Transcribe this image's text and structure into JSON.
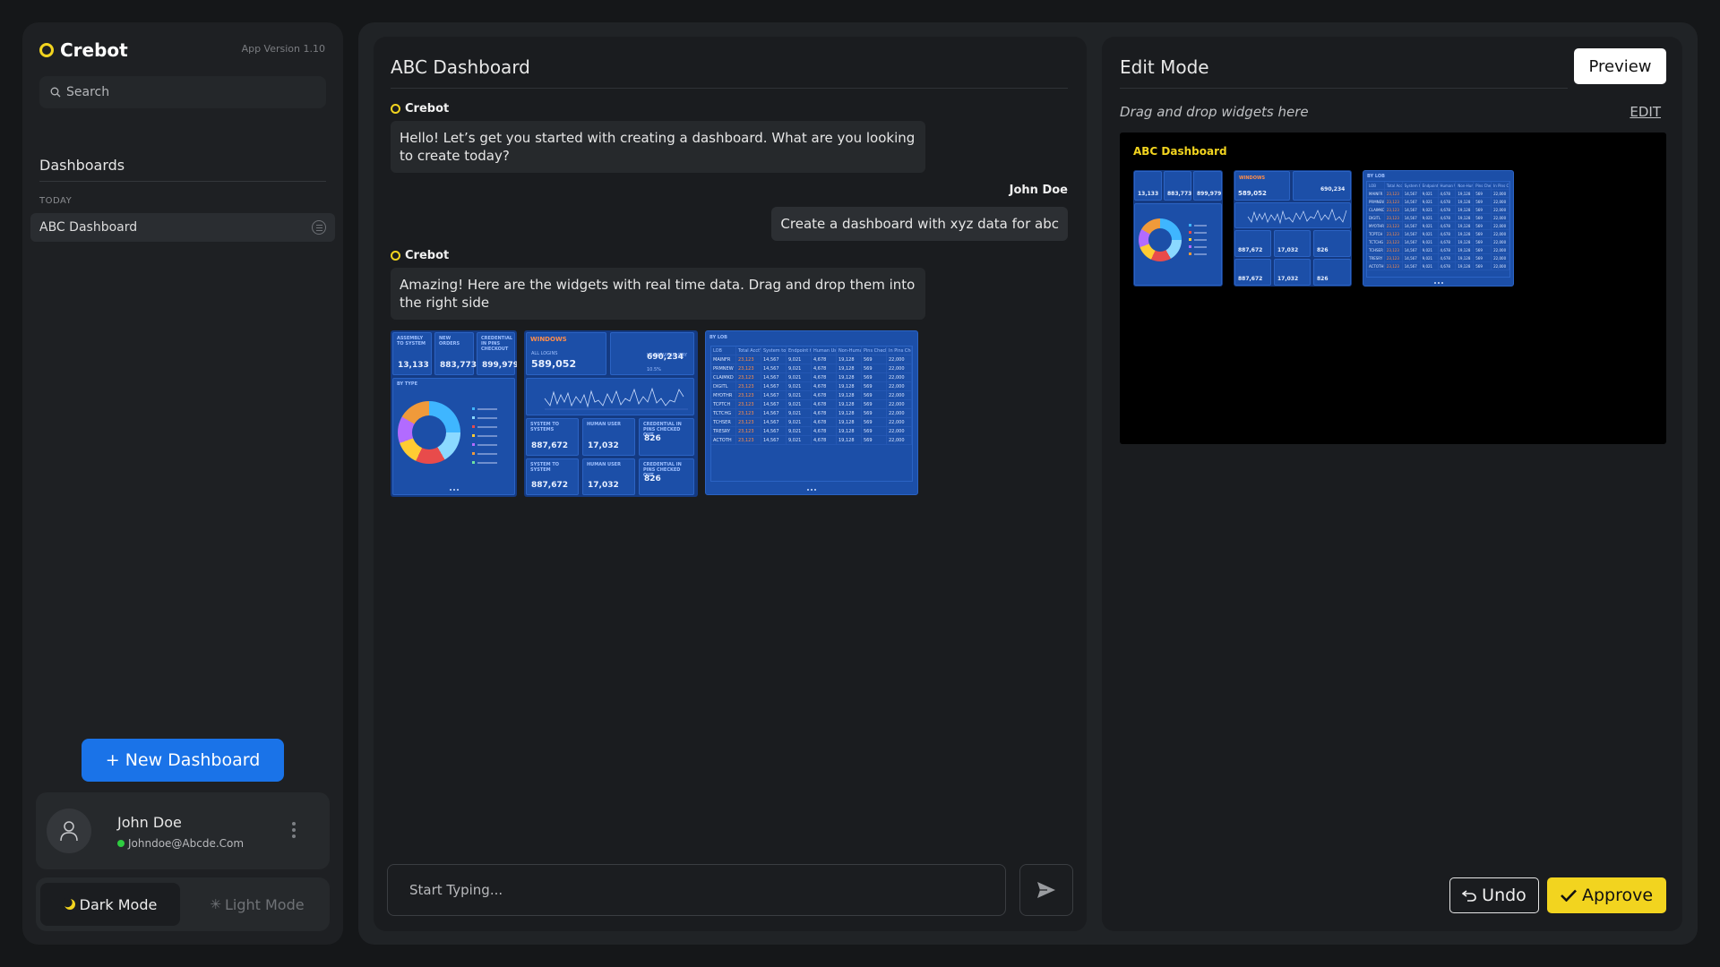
{
  "app": {
    "name": "Crebot",
    "version": "App Version 1.10"
  },
  "sidebar": {
    "search_placeholder": "Search",
    "section_title": "Dashboards",
    "group_label": "TODAY",
    "items": [
      {
        "label": "ABC Dashboard"
      }
    ],
    "new_dashboard_label": "+ New Dashboard",
    "user": {
      "name": "John Doe",
      "email": "Johndoe@Abcde.Com",
      "status_color": "#2ecc40"
    },
    "modes": {
      "dark_label": "Dark Mode",
      "light_label": "Light Mode",
      "active": "dark"
    }
  },
  "chat": {
    "title": "ABC Dashboard",
    "messages": [
      {
        "sender": "Crebot",
        "text": "Hello! Let’s get you started with creating a dashboard. What are you looking to create today?"
      },
      {
        "sender": "John Doe",
        "text": "Create a dashboard with xyz data for abc"
      },
      {
        "sender": "Crebot",
        "text": "Amazing! Here are the widgets with real time data. Drag and drop them into the right side"
      }
    ],
    "composer_placeholder": "Start Typing..."
  },
  "widgets": {
    "kpi": {
      "tiles": [
        {
          "title": "ASSEMBLY TO SYSTEM",
          "value": "13,133"
        },
        {
          "title": "NEW ORDERS",
          "value": "883,773"
        },
        {
          "title": "CREDENTIAL IN PINS CHECKOUT",
          "value": "899,979"
        }
      ],
      "donut_title": "BY TYPE"
    },
    "windows": {
      "title": "WINDOWS",
      "all_logins_label": "ALL LOGINS",
      "all_logins_value": "589,052",
      "prev_label": "VS PREVIOUS DAY",
      "prev_value": "690,234",
      "prev_pct": "10.5%",
      "tiles": [
        {
          "title": "SYSTEM TO SYSTEMS",
          "value": "887,672"
        },
        {
          "title": "HUMAN USER",
          "value": "17,032"
        },
        {
          "title": "CREDENTIAL IN PINS CHECKED OUT",
          "value": "826"
        },
        {
          "title": "SYSTEM TO SYSTEM",
          "value": "887,672"
        },
        {
          "title": "HUMAN USER",
          "value": "17,032"
        },
        {
          "title": "CREDENTIAL IN PINS CHECKED OUT",
          "value": "826"
        }
      ]
    },
    "table": {
      "title": "BY LOB",
      "headers": [
        "LOB",
        "Total Acct's",
        "System to System",
        "Endpoint to System",
        "Human User",
        "Non-Human User",
        "Pins Checked",
        "In Pins Checked"
      ],
      "rows": [
        [
          "MAINFR",
          "23,123",
          "14,567",
          "9,021",
          "4,678",
          "19,128",
          "569",
          "22,000"
        ],
        [
          "PRMNEW",
          "23,123",
          "14,567",
          "9,021",
          "4,678",
          "19,128",
          "569",
          "22,000"
        ],
        [
          "CLAIMKD",
          "23,123",
          "14,567",
          "9,021",
          "4,678",
          "19,128",
          "569",
          "22,000"
        ],
        [
          "DIGITL",
          "23,123",
          "14,567",
          "9,021",
          "4,678",
          "19,128",
          "569",
          "22,000"
        ],
        [
          "MYOTHR",
          "23,123",
          "14,567",
          "9,021",
          "4,678",
          "19,128",
          "569",
          "22,000"
        ],
        [
          "TCPTCH",
          "23,123",
          "14,567",
          "9,021",
          "4,678",
          "19,128",
          "569",
          "22,000"
        ],
        [
          "TCTCHG",
          "23,123",
          "14,567",
          "9,021",
          "4,678",
          "19,128",
          "569",
          "22,000"
        ],
        [
          "TCHSER",
          "23,123",
          "14,567",
          "9,021",
          "4,678",
          "19,128",
          "569",
          "22,000"
        ],
        [
          "TRESRY",
          "23,123",
          "14,567",
          "9,021",
          "4,678",
          "19,128",
          "569",
          "22,000"
        ],
        [
          "ACTOTH",
          "23,123",
          "14,567",
          "9,021",
          "4,678",
          "19,128",
          "569",
          "22,000"
        ]
      ]
    }
  },
  "edit": {
    "title": "Edit Mode",
    "preview_label": "Preview",
    "drag_hint": "Drag and drop widgets here",
    "edit_link": "EDIT",
    "canvas_title": "ABC Dashboard",
    "undo_label": "Undo",
    "approve_label": "Approve"
  },
  "colors": {
    "accent": "#f2d41f",
    "primary_button": "#1a73e8",
    "widget_bg": "#143a82",
    "widget_tile": "#1c4fa8",
    "highlight_orange": "#ff8d4a"
  },
  "icons": {
    "brand": "ring-logo-icon",
    "search": "search-icon",
    "item_menu": "list-menu-icon",
    "avatar": "user-icon",
    "more": "kebab-menu-icon",
    "dark_mode": "moon-icon",
    "light_mode": "sun-icon",
    "send": "send-icon",
    "undo": "undo-icon",
    "approve": "check-icon"
  }
}
